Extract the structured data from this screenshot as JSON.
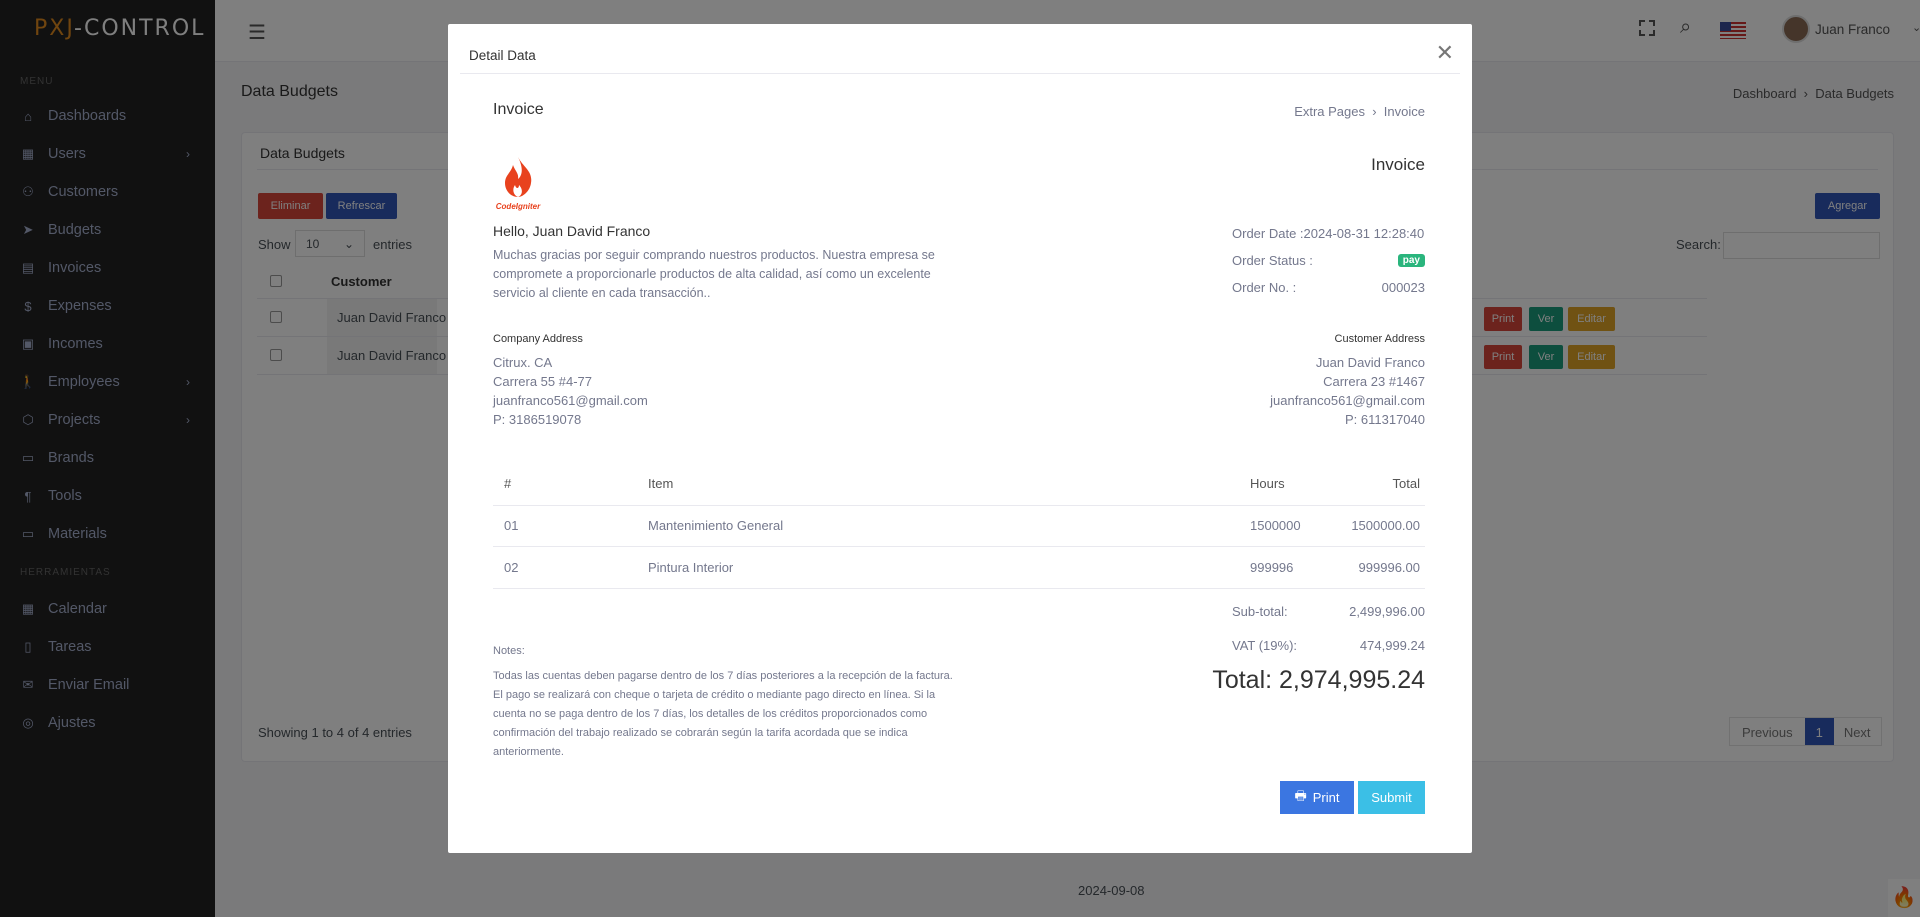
{
  "brand": {
    "part1": "PXJ",
    "part2": "-CONTROL"
  },
  "sidebar": {
    "menu_title": "MENU",
    "items": [
      {
        "label": "Dashboards",
        "icon": "home-icon"
      },
      {
        "label": "Users",
        "icon": "grid-icon"
      },
      {
        "label": "Customers",
        "icon": "user-check-icon"
      },
      {
        "label": "Budgets",
        "icon": "send-icon"
      },
      {
        "label": "Invoices",
        "icon": "file-icon"
      },
      {
        "label": "Expenses",
        "icon": "dollar-icon"
      },
      {
        "label": "Incomes",
        "icon": "briefcase-icon"
      },
      {
        "label": "Employees",
        "icon": "walk-icon"
      },
      {
        "label": "Projects",
        "icon": "box-icon"
      },
      {
        "label": "Brands",
        "icon": "archive-icon"
      },
      {
        "label": "Tools",
        "icon": "paint-roller-icon"
      },
      {
        "label": "Materials",
        "icon": "archive-icon"
      }
    ],
    "tools_title": "HERRAMIENTAS",
    "tools": [
      {
        "label": "Calendar",
        "icon": "calendar-icon"
      },
      {
        "label": "Tareas",
        "icon": "book-icon"
      },
      {
        "label": "Enviar Email",
        "icon": "mail-icon"
      },
      {
        "label": "Ajustes",
        "icon": "aperture-icon"
      }
    ]
  },
  "topbar": {
    "user_name": "Juan Franco"
  },
  "page": {
    "title": "Data Budgets",
    "breadcrumb": [
      "Dashboard",
      "Data Budgets"
    ],
    "card_title": "Data Budgets",
    "delete_label": "Eliminar",
    "refresh_label": "Refrescar",
    "add_label": "Agregar",
    "show_label": "Show",
    "entries_value": "10",
    "entries_label": "entries",
    "search_label": "Search:",
    "search_value": "",
    "column_customer": "Customer",
    "rows": [
      {
        "customer": "Juan David Franco"
      },
      {
        "customer": "Juan David Franco"
      }
    ],
    "row_actions": {
      "print": "Print",
      "view": "Ver",
      "edit": "Editar"
    },
    "showing": "Showing 1 to 4 of 4 entries",
    "pagination": {
      "previous": "Previous",
      "current": "1",
      "next": "Next"
    },
    "footer_date": "2024-09-08"
  },
  "modal": {
    "title": "Detail Data",
    "invoice_heading": "Invoice",
    "breadcrumb": [
      "Extra Pages",
      "Invoice"
    ],
    "invoice_label": "Invoice",
    "logo_text": "CodeIgniter",
    "greeting": "Hello, Juan David Franco",
    "message": "Muchas gracias por seguir comprando nuestros productos. Nuestra empresa se compromete a proporcionarle productos de alta calidad, así como un excelente servicio al cliente en cada transacción..",
    "order_date_label": "Order Date :",
    "order_date": "2024-08-31 12:28:40",
    "order_status_label": "Order Status :",
    "order_status": "pay",
    "order_no_label": "Order No. :",
    "order_no": "000023",
    "company": {
      "title": "Company Address",
      "lines": [
        "Citrux. CA",
        "Carrera 55 #4-77",
        "juanfranco561@gmail.com"
      ],
      "phone_label": "P:",
      "phone": "3186519078"
    },
    "customer": {
      "title": "Customer Address",
      "lines": [
        "Juan David Franco",
        "Carrera 23 #1467",
        "juanfranco561@gmail.com"
      ],
      "phone_label": "P:",
      "phone": "611317040"
    },
    "table": {
      "headers": [
        "#",
        "Item",
        "Hours",
        "Total"
      ],
      "rows": [
        [
          "01",
          "Mantenimiento General",
          "1500000",
          "1500000.00"
        ],
        [
          "02",
          "Pintura Interior",
          "999996",
          "999996.00"
        ]
      ]
    },
    "subtotal_label": "Sub-total:",
    "subtotal": "2,499,996.00",
    "vat_label": "VAT (19%):",
    "vat": "474,999.24",
    "total": "Total: 2,974,995.24",
    "notes_title": "Notes:",
    "notes": "Todas las cuentas deben pagarse dentro de los 7 días posteriores a la recepción de la factura. El pago se realizará con cheque o tarjeta de crédito o mediante pago directo en línea. Si la cuenta no se paga dentro de los 7 días, los detalles de los créditos proporcionados como confirmación del trabajo realizado se cobrarán según la tarifa acordada que se indica anteriormente.",
    "print_label": "Print",
    "submit_label": "Submit"
  }
}
